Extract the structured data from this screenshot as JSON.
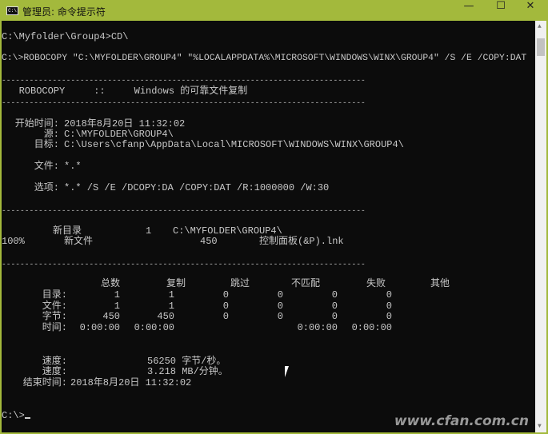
{
  "window": {
    "title": "管理员: 命令提示符",
    "minimize": "—",
    "maximize": "☐",
    "close": "✕",
    "app_icon": "C:\\"
  },
  "console": {
    "line1": "C:\\Myfolder\\Group4>CD\\",
    "line2": "C:\\>ROBOCOPY \"C:\\MYFOLDER\\GROUP4\" \"%LOCALAPPDATA%\\MICROSOFT\\WINDOWS\\WINX\\GROUP4\" /S /E /COPY:DAT",
    "dashes": "-------------------------------------------------------------------------------",
    "header": "   ROBOCOPY     ::     Windows 的可靠文件复制",
    "start_label": "开始时间:",
    "start_value": "2018年8月20日 11:32:02",
    "source_label": "源:",
    "source_value": "C:\\MYFOLDER\\GROUP4\\",
    "dest_label": "目标:",
    "dest_value": "C:\\Users\\cfanp\\AppData\\Local\\MICROSOFT\\WINDOWS\\WINX\\GROUP4\\",
    "files_label": "文件:",
    "files_value": "*.*",
    "options_label": "选项:",
    "options_value": "*.* /S /E /DCOPY:DA /COPY:DAT /R:1000000 /W:30",
    "newdir_label": "新目录",
    "newdir_count": "1",
    "newdir_path": "C:\\MYFOLDER\\GROUP4\\",
    "progress": "100%",
    "newfile_label": "新文件",
    "newfile_size": "450",
    "newfile_name": "控制面板(&P).lnk",
    "summary": {
      "headers": [
        "总数",
        "复制",
        "跳过",
        "不匹配",
        "失败",
        "其他"
      ],
      "rows": [
        {
          "label": "目录:",
          "values": [
            "1",
            "1",
            "0",
            "0",
            "0",
            "0"
          ]
        },
        {
          "label": "文件:",
          "values": [
            "1",
            "1",
            "0",
            "0",
            "0",
            "0"
          ]
        },
        {
          "label": "字节:",
          "values": [
            "450",
            "450",
            "0",
            "0",
            "0",
            "0"
          ]
        },
        {
          "label": "时间:",
          "values": [
            "0:00:00",
            "0:00:00",
            "",
            "",
            "0:00:00",
            "0:00:00"
          ]
        }
      ]
    },
    "speed1_label": "速度:",
    "speed1_value": "56250 字节/秒。",
    "speed2_label": "速度:",
    "speed2_value": "3.218 MB/分钟。",
    "end_label": "结束时间:",
    "end_value": "2018年8月20日 11:32:02",
    "prompt": "C:\\>"
  },
  "watermark": "www.cfan.com.cn"
}
